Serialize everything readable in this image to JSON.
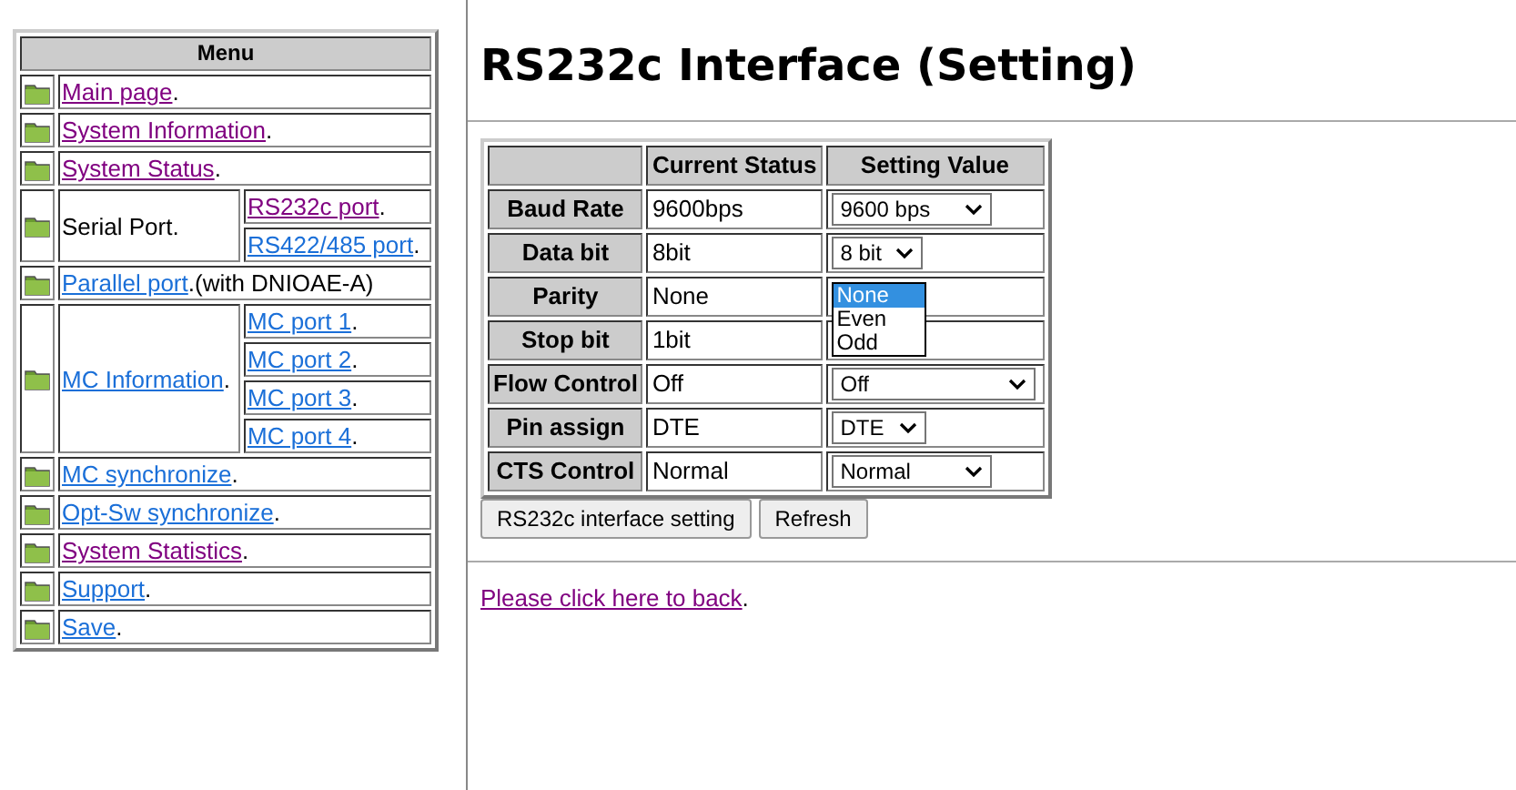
{
  "menu": {
    "title": "Menu",
    "items": [
      {
        "kind": "link",
        "label": "Main page",
        "suffix": ".",
        "visited": true
      },
      {
        "kind": "link",
        "label": "System Information",
        "suffix": ".",
        "visited": true
      },
      {
        "kind": "link",
        "label": "System Status",
        "suffix": ".",
        "visited": true
      },
      {
        "kind": "group",
        "label": "Serial Port.",
        "children": [
          {
            "label": "RS232c port",
            "suffix": ".",
            "visited": true
          },
          {
            "label": "RS422/485 port",
            "suffix": ".",
            "visited": false
          }
        ]
      },
      {
        "kind": "link",
        "label": "Parallel port",
        "suffix": ".(with DNIOAE-A)",
        "visited": false
      },
      {
        "kind": "linkgroup",
        "label": "MC Information",
        "suffix": ".",
        "visited": false,
        "children": [
          {
            "label": "MC port 1",
            "suffix": ".",
            "visited": false
          },
          {
            "label": "MC port 2",
            "suffix": ".",
            "visited": false
          },
          {
            "label": "MC port 3",
            "suffix": ".",
            "visited": false
          },
          {
            "label": "MC port 4",
            "suffix": ".",
            "visited": false
          }
        ]
      },
      {
        "kind": "link",
        "label": "MC synchronize",
        "suffix": ".",
        "visited": false
      },
      {
        "kind": "link",
        "label": "Opt-Sw synchronize",
        "suffix": ".",
        "visited": false
      },
      {
        "kind": "link",
        "label": "System Statistics",
        "suffix": ".",
        "visited": true
      },
      {
        "kind": "link",
        "label": "Support",
        "suffix": ".",
        "visited": false
      },
      {
        "kind": "link",
        "label": "Save",
        "suffix": ".",
        "visited": false
      }
    ]
  },
  "title": "RS232c Interface (Setting)",
  "table": {
    "columns": [
      "Current Status",
      "Setting Value"
    ],
    "rows": [
      {
        "label": "Baud Rate",
        "current": "9600bps",
        "setting": {
          "kind": "select",
          "value": "9600 bps"
        }
      },
      {
        "label": "Data bit",
        "current": "8bit",
        "setting": {
          "kind": "select",
          "value": "8 bit"
        }
      },
      {
        "label": "Parity",
        "current": "None",
        "setting": {
          "kind": "open-list",
          "options": [
            {
              "label": "None",
              "selected": true
            },
            {
              "label": "Even",
              "selected": false
            },
            {
              "label": "Odd",
              "selected": false
            }
          ]
        }
      },
      {
        "label": "Stop bit",
        "current": "1bit",
        "setting": {
          "kind": "hidden"
        }
      },
      {
        "label": "Flow Control",
        "current": "Off",
        "setting": {
          "kind": "select",
          "value": "Off",
          "wide": true
        }
      },
      {
        "label": "Pin assign",
        "current": "DTE",
        "setting": {
          "kind": "select",
          "value": "DTE"
        }
      },
      {
        "label": "CTS Control",
        "current": "Normal",
        "setting": {
          "kind": "select",
          "value": "Normal"
        }
      }
    ]
  },
  "buttons": [
    "RS232c interface setting",
    "Refresh"
  ],
  "back_link": {
    "label": "Please click here to back",
    "suffix": ".",
    "visited": true
  }
}
